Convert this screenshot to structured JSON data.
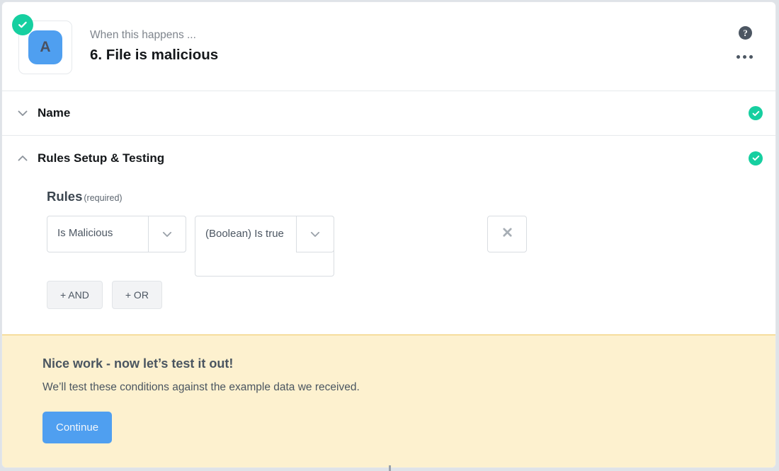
{
  "header": {
    "eyebrow": "When this happens ...",
    "title": "6. File is malicious",
    "app_icon_letter": "A",
    "status_icon": "check-circle-icon",
    "help_icon": "?",
    "more_icon": "ellipsis-icon"
  },
  "sections": [
    {
      "label": "Name",
      "chevron": "chevron-down-icon",
      "status": "complete",
      "expanded": false
    },
    {
      "label": "Rules Setup & Testing",
      "chevron": "chevron-up-icon",
      "status": "complete",
      "expanded": true
    }
  ],
  "rules": {
    "label": "Rules",
    "required_note": "(required)",
    "row": {
      "field_value": "Is Malicious",
      "operator_value": "(Boolean) Is true",
      "field_arrow_icon": "chevron-down-icon",
      "operator_arrow_icon": "chevron-down-icon",
      "remove_icon": "close-x-icon"
    },
    "and_label": "+ AND",
    "or_label": "+ OR"
  },
  "notice": {
    "title": "Nice work - now let’s test it out!",
    "subtitle": "We’ll test these conditions against the example data we received.",
    "button_label": "Continue"
  },
  "colors": {
    "accent_blue": "#4f9ff0",
    "success_green": "#16cfa0",
    "notice_bg": "#fdf1cf",
    "notice_border": "#f0c75e",
    "page_bg": "#dfe3e8"
  }
}
